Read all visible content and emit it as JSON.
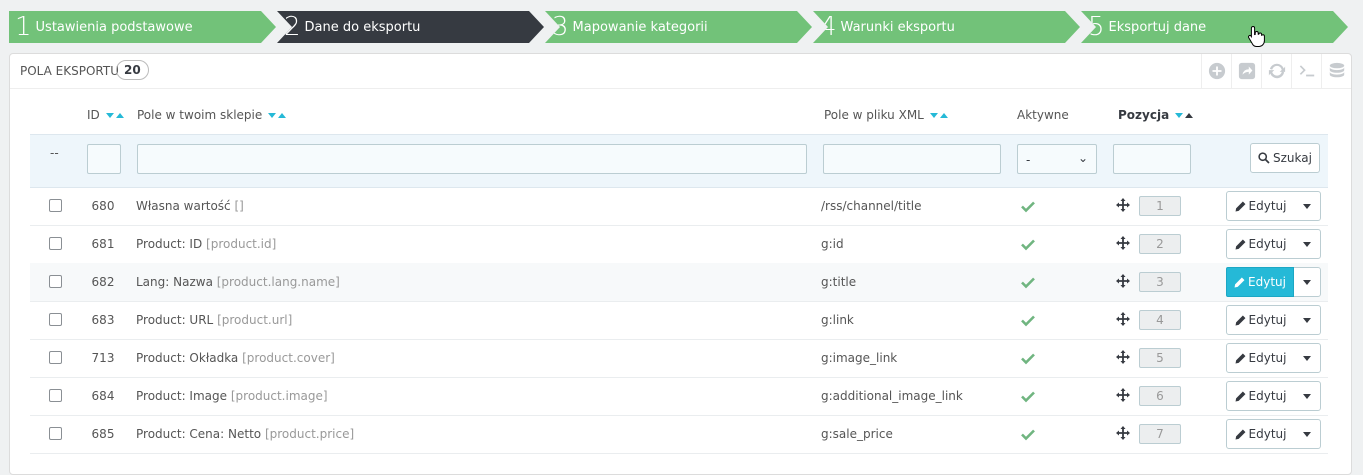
{
  "steps": [
    {
      "num": "1",
      "label": "Ustawienia podstawowe",
      "active": false
    },
    {
      "num": "2",
      "label": "Dane do eksportu",
      "active": true
    },
    {
      "num": "3",
      "label": "Mapowanie kategorii",
      "active": false
    },
    {
      "num": "4",
      "label": "Warunki eksportu",
      "active": false
    },
    {
      "num": "5",
      "label": "Eksportuj dane",
      "active": false
    }
  ],
  "panel": {
    "title": "POLA EKSPORTU",
    "count": "20",
    "toolbar_icons": [
      "add-icon",
      "export-icon",
      "refresh-icon",
      "sql-icon",
      "database-icon"
    ]
  },
  "table": {
    "headers": {
      "id": "ID",
      "field": "Pole w twoim sklepie",
      "xml": "Pole w pliku XML",
      "active": "Aktywne",
      "position": "Pozycja"
    },
    "filters": {
      "bulk": "--",
      "active_value": "-",
      "search_label": "Szukaj"
    },
    "edit_label": "Edytuj",
    "rows": [
      {
        "id": "680",
        "field": "Własna wartość",
        "tag": "[]",
        "xml": "/rss/channel/title",
        "position": "1"
      },
      {
        "id": "681",
        "field": "Product: ID",
        "tag": "[product.id]",
        "xml": "g:id",
        "position": "2"
      },
      {
        "id": "682",
        "field": "Lang: Nazwa",
        "tag": "[product.lang.name]",
        "xml": "g:title",
        "position": "3"
      },
      {
        "id": "683",
        "field": "Product: URL",
        "tag": "[product.url]",
        "xml": "g:link",
        "position": "4"
      },
      {
        "id": "713",
        "field": "Product: Okładka",
        "tag": "[product.cover]",
        "xml": "g:image_link",
        "position": "5"
      },
      {
        "id": "684",
        "field": "Product: Image",
        "tag": "[product.image]",
        "xml": "g:additional_image_link",
        "position": "6"
      },
      {
        "id": "685",
        "field": "Product: Cena: Netto",
        "tag": "[product.price]",
        "xml": "g:sale_price",
        "position": "7"
      }
    ]
  },
  "colors": {
    "step_done": "#72c279",
    "step_active": "#363a41",
    "accent": "#25b9d7",
    "check": "#70b580"
  }
}
